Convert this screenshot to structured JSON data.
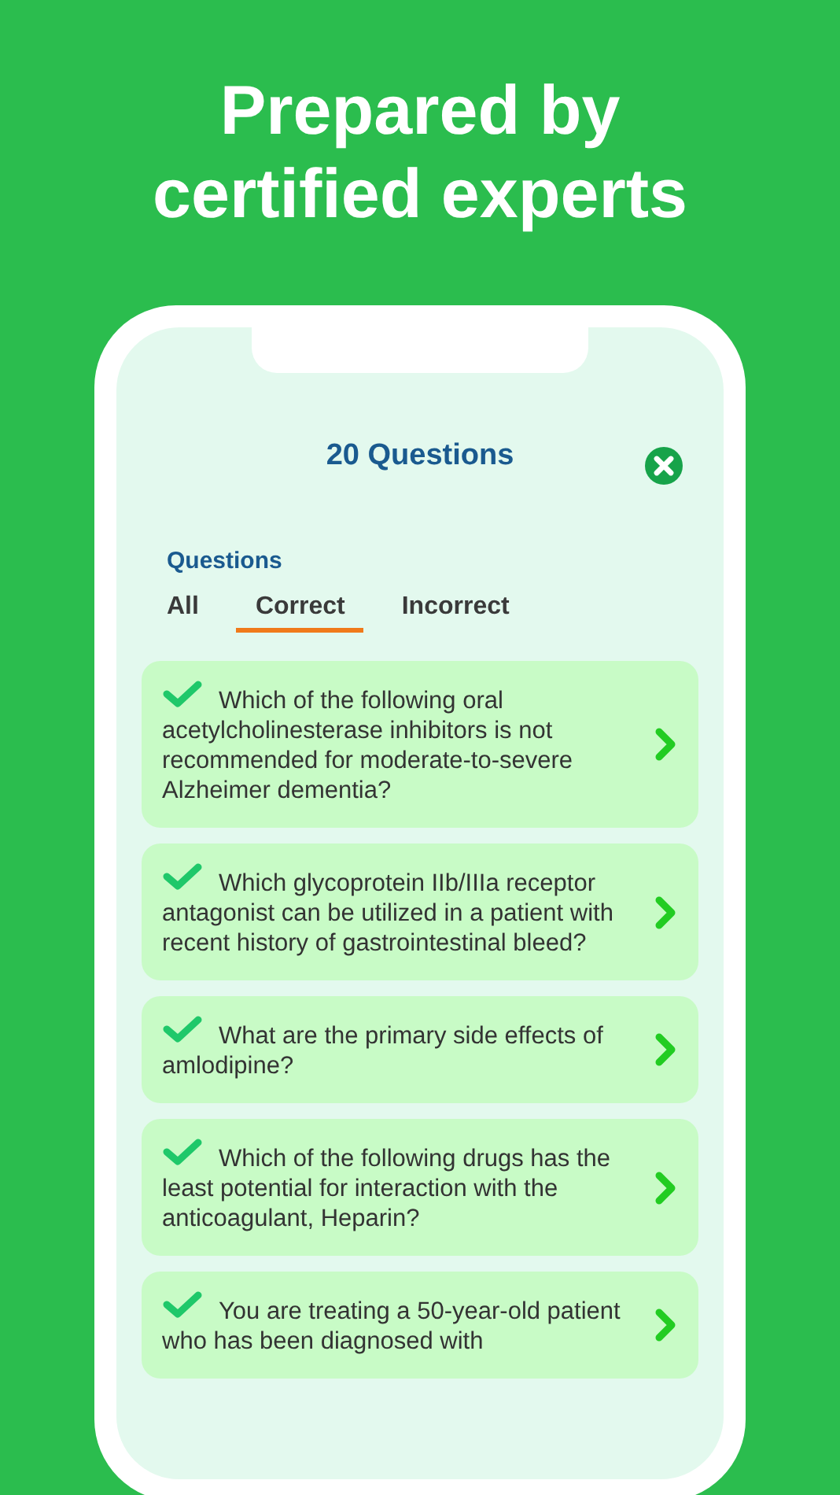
{
  "headline": "Prepared by certified experts",
  "screen": {
    "title": "20 Questions",
    "section_label": "Questions",
    "tabs": [
      {
        "label": "All",
        "selected": false
      },
      {
        "label": "Correct",
        "selected": true
      },
      {
        "label": "Incorrect",
        "selected": false
      }
    ],
    "questions": [
      {
        "text": "Which of the following oral acetylcholinesterase inhibitors is not recommended for moderate-to-severe Alzheimer dementia?",
        "correct": true
      },
      {
        "text": "Which glycoprotein IIb/IIIa receptor antagonist can be utilized in a patient with recent history of gastrointestinal bleed?",
        "correct": true
      },
      {
        "text": "What are the primary side effects of amlodipine?",
        "correct": true
      },
      {
        "text": "Which of the following drugs has the least potential for interaction with the anticoagulant, Heparin?",
        "correct": true
      },
      {
        "text": "You are treating a 50-year-old patient who has been diagnosed with",
        "correct": true
      }
    ]
  }
}
